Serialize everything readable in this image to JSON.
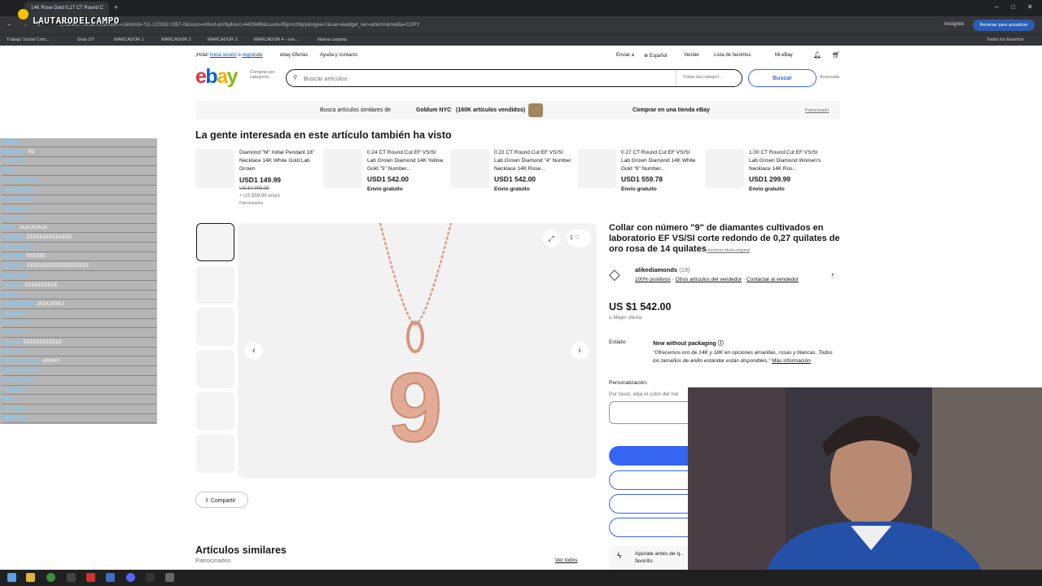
{
  "browser": {
    "tab_title": "14K Rose Gold 0,27 CT Round C",
    "url": "17324917mkcid=16&mkevt=1&mkrid=711-127632-2357-0&sssrc=mbvvt-pcr9y&ssrc=4429486&ssuid=t5lymcz9qry&stype=1&var=&widget_ver=artemis&media=COPY",
    "incognito": "Incógnito",
    "update": "Reiniciar para actualizar",
    "watermark": "LAUTARODELCAMPO",
    "bookmarks": [
      "Trabajo Social Com...",
      "Gran DT",
      "MARCADOR 1",
      "MARCADOR 2",
      "MARCADOR 3",
      "MARCADOR 4 - ove...",
      "Nueva carpeta"
    ],
    "all_bookmarks": "Todos los favoritos"
  },
  "ebay": {
    "topbar": {
      "hola": "¡Hola!",
      "iniciar": "Inicia sesión",
      "o": "o",
      "registrate": "regístrate",
      "ofertas": "ebay Ofertas",
      "ayuda": "Ayuda y contacto",
      "enviar": "Enviar a",
      "idioma": "Español",
      "vender": "Vender",
      "favoritos": "Lista de favoritos",
      "miebay": "Mi eBay"
    },
    "search": {
      "comprar_por": "Comprar por categoría",
      "placeholder": "Buscar artículos",
      "all_categories": "Todas las categorí...",
      "button": "Buscar",
      "advanced": "Avanzada"
    },
    "banner": {
      "text": "Busca artículos similares de",
      "store": "Goldum NYC",
      "count": "(160K artículos vendidos)",
      "cta": "Comprar en una tienda eBay",
      "sponsored": "Patrocinado"
    },
    "also_viewed": {
      "heading": "La gente interesada en este artículo también ha visto",
      "items": [
        {
          "title": "Diamond \"M\" Initial Pendant 18\" Necklace 14K White Gold Lab Grown",
          "price": "USD1 149.99",
          "old": "US $4 999.95",
          "ship": "+ US $59.99 envío",
          "tag": "Patrocinados"
        },
        {
          "title": "0.24 CT Round Cut EF VS/SI Lab Grown Diamond 14K Yellow Gold \"5\" Number...",
          "price": "USD1 542.00",
          "ship": "Envío gratuito"
        },
        {
          "title": "0.22 CT Round Cut EF VS/SI Lab Grown Diamond \"4\" Number Necklace 14K Rose...",
          "price": "USD1 542.00",
          "ship": "Envío gratuito"
        },
        {
          "title": "0.27 CT Round Cut EF VS/SI Lab Grown Diamond 14K White Gold \"8\" Number...",
          "price": "USD1 559.78",
          "ship": "Envío gratuito"
        },
        {
          "title": "1.00 CT Round Cut EF VS/SI Lab Grown Diamond Women's Necklace 14K Ros...",
          "price": "USD1 299.99",
          "ship": "Envío gratuito"
        }
      ]
    },
    "product": {
      "title": "Collar con número \"9\" de diamantes cultivados en laboratorio EF VS/SI corte redondo de 0,27 quilates de oro rosa de 14 quilates",
      "show_original": "-mostrar título original",
      "seller": "alikediamonds",
      "seller_count": "(19)",
      "positive": "100% positivos",
      "other_items": "Otros artículos del vendedor",
      "contact": "Contactar al vendedor",
      "price": "US $1 542.00",
      "best_offer": "o Mejor oferta",
      "estado_label": "Estado:",
      "estado": "New without packaging",
      "desc": "Ofrecemos oro de 14K y 18K en opciones amarillas, rosas y blancas. Todos los tamaños de anillo estándar están disponibles.",
      "mas": "Más información",
      "personalizacion": "Personalización:",
      "elige": "Por favor, elija el color del me",
      "watch_count": "1",
      "share": "Compartir",
      "numeral": "9"
    },
    "similar": {
      "heading": "Artículos similares",
      "sub": "Patrocinados",
      "ver_todos": "Ver todos"
    },
    "promo": "Apúrate antes de q... favorito."
  },
  "chat": [
    {
      "u": "Gabo(x)",
      "m": ""
    },
    {
      "u": "Axelmo97",
      "m": "XD"
    },
    {
      "u": "Jomar172",
      "m": ""
    },
    {
      "u": "Pibel",
      "m": ""
    },
    {
      "u": "vegeta2008167",
      "m": ""
    },
    {
      "u": "sebacarranza",
      "m": ""
    },
    {
      "u": "EnzoPacha69",
      "m": ""
    },
    {
      "u": "adrianalaco",
      "m": ""
    },
    {
      "u": "Mayoloff",
      "m": ""
    },
    {
      "u": "Doido",
      "m": "JAJAJAJAJA"
    },
    {
      "u": "tomaslira",
      "m": "EEEEEEEEEEEEEE"
    },
    {
      "u": "MiguelusRS76",
      "m": ""
    },
    {
      "u": "tmer1999",
      "m": "EEEEEE"
    },
    {
      "u": "anne2364",
      "m": "EEEEEEEEEEEEEEEEEEE"
    },
    {
      "u": "Diego_h23",
      "m": ""
    },
    {
      "u": "Juansito",
      "m": "EEEEEEEEEE"
    },
    {
      "u": "DiarPac",
      "m": ""
    },
    {
      "u": "FERRANDITO",
      "m": "JKSKJSSKJ"
    },
    {
      "u": "cabrouom",
      "m": ""
    },
    {
      "u": "jeronimo_09",
      "m": ""
    },
    {
      "u": "benjaa_31",
      "m": ""
    },
    {
      "u": "Falcon1",
      "m": "EEEEEEEEEEEE"
    },
    {
      "u": "naza_777",
      "m": ""
    },
    {
      "u": "rafael_escalante",
      "m": "ehhhh!!"
    },
    {
      "u": "pollitocinchoo4",
      "m": ""
    },
    {
      "u": "daligarlovever",
      "m": ""
    },
    {
      "u": "JonasGTZ",
      "m": ""
    },
    {
      "u": "Pibel",
      "m": ""
    },
    {
      "u": "tmer1999",
      "m": ""
    },
    {
      "u": "Diego_h23",
      "m": ""
    }
  ]
}
